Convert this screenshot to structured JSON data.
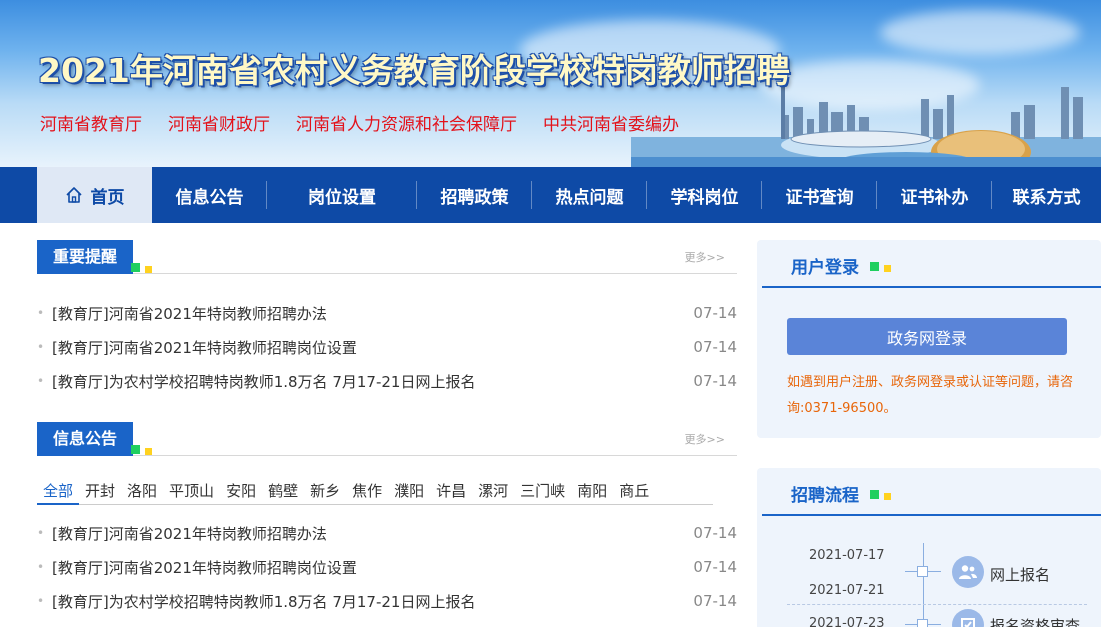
{
  "banner": {
    "title": "2021年河南省农村义务教育阶段学校特岗教师招聘",
    "orgs": [
      "河南省教育厅",
      "河南省财政厅",
      "河南省人力资源和社会保障厅",
      "中共河南省委编办"
    ]
  },
  "nav": {
    "items": [
      "首页",
      "信息公告",
      "岗位设置",
      "招聘政策",
      "热点问题",
      "学科岗位",
      "证书查询",
      "证书补办",
      "联系方式"
    ]
  },
  "important": {
    "title": "重要提醒",
    "more": "更多>>",
    "rows": [
      {
        "title": "[教育厅]河南省2021年特岗教师招聘办法",
        "date": "07-14"
      },
      {
        "title": "[教育厅]河南省2021年特岗教师招聘岗位设置",
        "date": "07-14"
      },
      {
        "title": "[教育厅]为农村学校招聘特岗教师1.8万名 7月17-21日网上报名",
        "date": "07-14"
      }
    ]
  },
  "notices": {
    "title": "信息公告",
    "more": "更多>>",
    "cities": [
      "全部",
      "开封",
      "洛阳",
      "平顶山",
      "安阳",
      "鹤壁",
      "新乡",
      "焦作",
      "濮阳",
      "许昌",
      "漯河",
      "三门峡",
      "南阳",
      "商丘"
    ],
    "rows": [
      {
        "title": "[教育厅]河南省2021年特岗教师招聘办法",
        "date": "07-14"
      },
      {
        "title": "[教育厅]河南省2021年特岗教师招聘岗位设置",
        "date": "07-14"
      },
      {
        "title": "[教育厅]为农村学校招聘特岗教师1.8万名 7月17-21日网上报名",
        "date": "07-14"
      }
    ]
  },
  "login": {
    "title": "用户登录",
    "button": "政务网登录",
    "note": "如遇到用户注册、政务网登录或认证等问题，请咨询:0371-96500。"
  },
  "process": {
    "title": "招聘流程",
    "dates": [
      "2021-07-17",
      "2021-07-21",
      "2021-07-23"
    ],
    "steps": [
      "网上报名",
      "报名资格审查"
    ]
  },
  "colors": {
    "nav": "#0e4aa6",
    "accent": "#1a64c8",
    "warning": "#e8660a",
    "org": "#e3121b"
  }
}
